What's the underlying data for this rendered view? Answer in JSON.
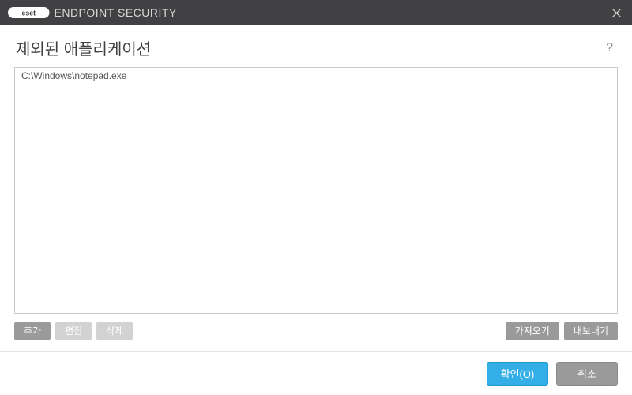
{
  "titlebar": {
    "brand_text": "eset",
    "product_name": "ENDPOINT SECURITY"
  },
  "header": {
    "title": "제외된 애플리케이션"
  },
  "list": {
    "items": [
      {
        "path": "C:\\Windows\\notepad.exe"
      }
    ]
  },
  "actions": {
    "add": "추가",
    "edit": "편집",
    "delete": "삭제",
    "import": "가져오기",
    "export": "내보내기"
  },
  "footer": {
    "ok": "확인(O)",
    "cancel": "취소"
  }
}
